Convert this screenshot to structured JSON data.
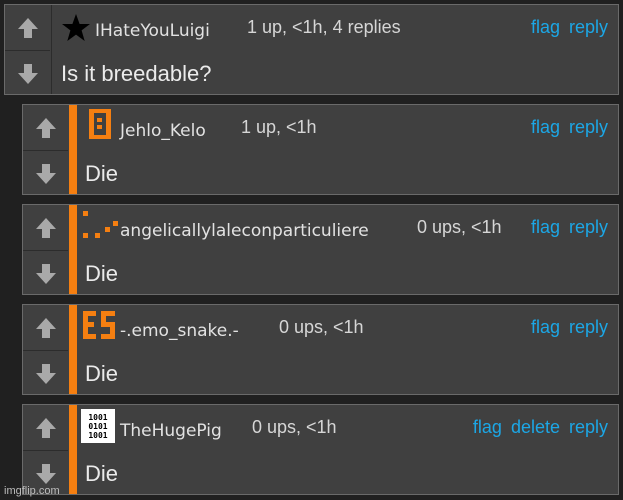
{
  "icons": {
    "upvote": "up-arrow-icon",
    "downvote": "down-arrow-icon"
  },
  "colors": {
    "accent": "#f57f11",
    "link": "#1ca7e6",
    "panel": "#404040",
    "page_bg": "#202020"
  },
  "comments": [
    {
      "username": "IHateYouLuigi",
      "meta": "1 up, <1h, 4 replies",
      "body": "Is it breedable?",
      "avatar": "star-icon",
      "actions": [
        "flag",
        "reply"
      ]
    },
    {
      "username": "Jehlo_Kelo",
      "meta": "1 up, <1h",
      "body": "Die",
      "avatar": "pixel-zero-icon",
      "actions": [
        "flag",
        "reply"
      ]
    },
    {
      "username": "angelicallylaleconparticuliere",
      "meta": "0 ups, <1h",
      "body": "Die",
      "avatar": "pixel-dots-icon",
      "actions": [
        "flag",
        "reply"
      ]
    },
    {
      "username": "-.emo_snake.-",
      "meta": "0 ups, <1h",
      "body": "Die",
      "avatar": "es-letters-icon",
      "actions": [
        "flag",
        "reply"
      ]
    },
    {
      "username": "TheHugePig",
      "meta": "0 ups, <1h",
      "body": "Die",
      "avatar": "binary-code-icon",
      "avatar_lines": [
        "1001",
        "0101",
        "1001"
      ],
      "actions": [
        "flag",
        "delete",
        "reply"
      ]
    }
  ],
  "watermark": "imgflip.com"
}
